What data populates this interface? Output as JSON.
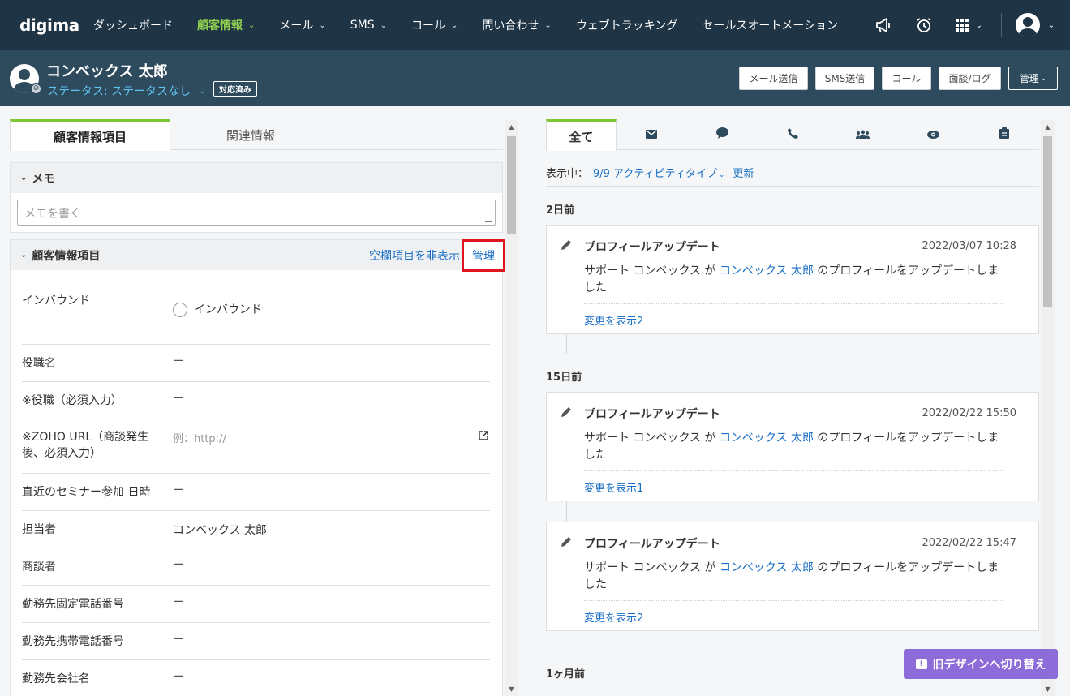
{
  "nav": {
    "logo": "digima",
    "items": [
      {
        "label": "ダッシュボード",
        "chevron": false,
        "active": false
      },
      {
        "label": "顧客情報",
        "chevron": true,
        "active": true
      },
      {
        "label": "メール",
        "chevron": true,
        "active": false
      },
      {
        "label": "SMS",
        "chevron": true,
        "active": false
      },
      {
        "label": "コール",
        "chevron": true,
        "active": false
      },
      {
        "label": "問い合わせ",
        "chevron": true,
        "active": false
      },
      {
        "label": "ウェブトラッキング",
        "chevron": false,
        "active": false
      },
      {
        "label": "セールスオートメーション",
        "chevron": false,
        "active": false
      }
    ],
    "icons": [
      "megaphone-icon",
      "alarm-clock-icon",
      "apps-grid-icon",
      "user-avatar-icon"
    ]
  },
  "customer": {
    "name": "コンベックス 太郎",
    "status": "ステータス: ステータスなし",
    "tag": "対応済み",
    "buttons": {
      "email": "メール送信",
      "sms": "SMS送信",
      "call": "コール",
      "log": "面談/ログ",
      "manage": "管理"
    }
  },
  "left": {
    "tabs": {
      "info": "顧客情報項目",
      "related": "関連情報"
    },
    "memo": {
      "title": "メモ",
      "placeholder": "メモを書く"
    },
    "fields_section": {
      "title": "顧客情報項目",
      "hide_empty": "空欄項目を非表示",
      "manage": "管理"
    },
    "fields": {
      "inbound_label": "インバウンド",
      "inbound_radio": "インバウンド",
      "position_label": "役職名",
      "position_value": "ー",
      "position_req_label": "※役職（必須入力）",
      "position_req_value": "ー",
      "zoho_label_1": "※ZOHO URL（商談発生",
      "zoho_label_2": "後、必須入力）",
      "zoho_placeholder": "例：http://",
      "seminar_label": "直近のセミナー参加 日時",
      "seminar_value": "ー",
      "owner_label": "担当者",
      "owner_value": "コンベックス 太郎",
      "negotiator_label": "商談者",
      "negotiator_value": "ー",
      "office_phone_label": "勤務先固定電話番号",
      "office_phone_value": "ー",
      "office_mobile_label": "勤務先携帯電話番号",
      "office_mobile_value": "ー",
      "company_label": "勤務先会社名",
      "company_value": "ー"
    }
  },
  "right": {
    "tabs": {
      "all": "全て"
    },
    "tab_icons": [
      "mail-icon",
      "chat-bubble-icon",
      "phone-icon",
      "group-icon",
      "eye-icon",
      "clipboard-icon"
    ],
    "filter": {
      "prefix": "表示中：",
      "types": "9/9 アクティビティタイプ",
      "refresh": "更新"
    },
    "groups": [
      {
        "day": "2日前"
      },
      {
        "day": "15日前"
      },
      {
        "day": "1ヶ月前"
      }
    ],
    "cards": [
      {
        "title": "プロフィールアップデート",
        "time": "2022/03/07 10:28",
        "actor": "サポート コンベックス が",
        "target": "コンベックス 太郎",
        "suffix": "のプロフィールをアップデートしま",
        "suffix2": "した",
        "more": "変更を表示2"
      },
      {
        "title": "プロフィールアップデート",
        "time": "2022/02/22 15:50",
        "actor": "サポート コンベックス が",
        "target": "コンベックス 太郎",
        "suffix": "のプロフィールをアップデートしま",
        "suffix2": "した",
        "more": "変更を表示1"
      },
      {
        "title": "プロフィールアップデート",
        "time": "2022/02/22 15:47",
        "actor": "サポート コンベックス が",
        "target": "コンベックス 太郎",
        "suffix": "のプロフィールをアップデートしま",
        "suffix2": "した",
        "more": "変更を表示2"
      }
    ]
  },
  "switch_button": "旧デザインへ切り替え",
  "colors": {
    "nav_bg": "#1f3444",
    "header_bg": "#2e4a5d",
    "accent_green": "#7bc832",
    "link_blue": "#1a6fc4",
    "highlight_red": "#e0141e",
    "switch_purple": "#8d6bd8"
  }
}
